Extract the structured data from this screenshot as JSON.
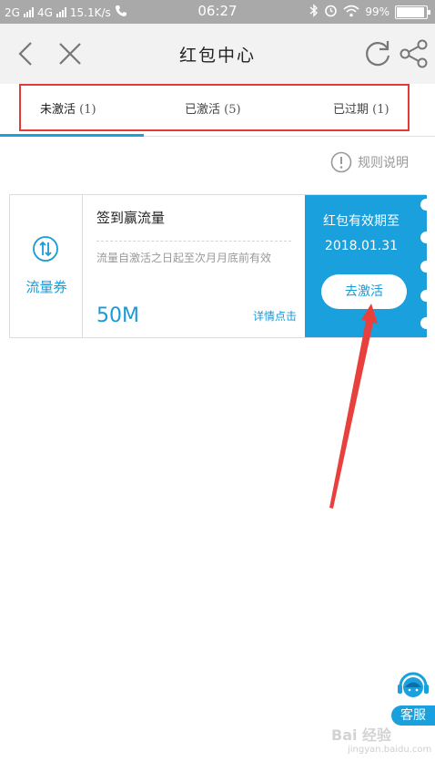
{
  "status_bar": {
    "network_1": "2G",
    "network_2": "4G",
    "speed": "15.1K/s",
    "time": "06:27",
    "battery": "99%"
  },
  "nav": {
    "title": "红包中心"
  },
  "tabs": [
    {
      "label": "未激活",
      "count": "(1)"
    },
    {
      "label": "已激活",
      "count": "(5)"
    },
    {
      "label": "已过期",
      "count": "(1)"
    }
  ],
  "rules_link": "规则说明",
  "coupon": {
    "type_label": "流量券",
    "title": "签到赢流量",
    "description": "流量自激活之日起至次月月底前有效",
    "amount": "50M",
    "detail_link": "详情点击",
    "expiry_label": "红包有效期至",
    "expiry_date": "2018.01.31",
    "activate_label": "去激活"
  },
  "customer_service_label": "客服",
  "watermark": {
    "main": "Bai 经验",
    "sub": "jingyan.baidu.com"
  },
  "colors": {
    "accent": "#1aa0dd",
    "highlight_box": "#e03a3a",
    "status_bar": "#a9a9a9"
  }
}
